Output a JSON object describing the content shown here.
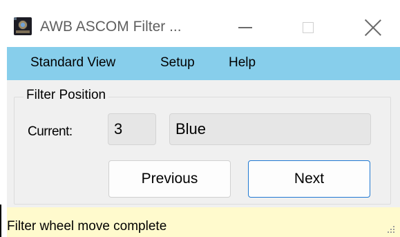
{
  "window": {
    "title": "AWB ASCOM Filter ...",
    "app_icon": "telescope-eye-icon",
    "controls": [
      "minimize-icon",
      "maximize-icon",
      "close-icon"
    ]
  },
  "menubar": {
    "items": [
      {
        "label": "Standard View"
      },
      {
        "label": "Setup"
      },
      {
        "label": "Help"
      }
    ],
    "background": "#87ceeb"
  },
  "filter_group": {
    "title": "Filter Position",
    "current_label": "Current:",
    "current_number": "3",
    "current_name": "Blue",
    "previous_label": "Previous",
    "next_label": "Next"
  },
  "statusbar": {
    "text": "Filter wheel move complete",
    "background": "#fffacd"
  },
  "colors": {
    "focus_border": "#1f78d2",
    "window_bg": "#f0f0f0"
  }
}
